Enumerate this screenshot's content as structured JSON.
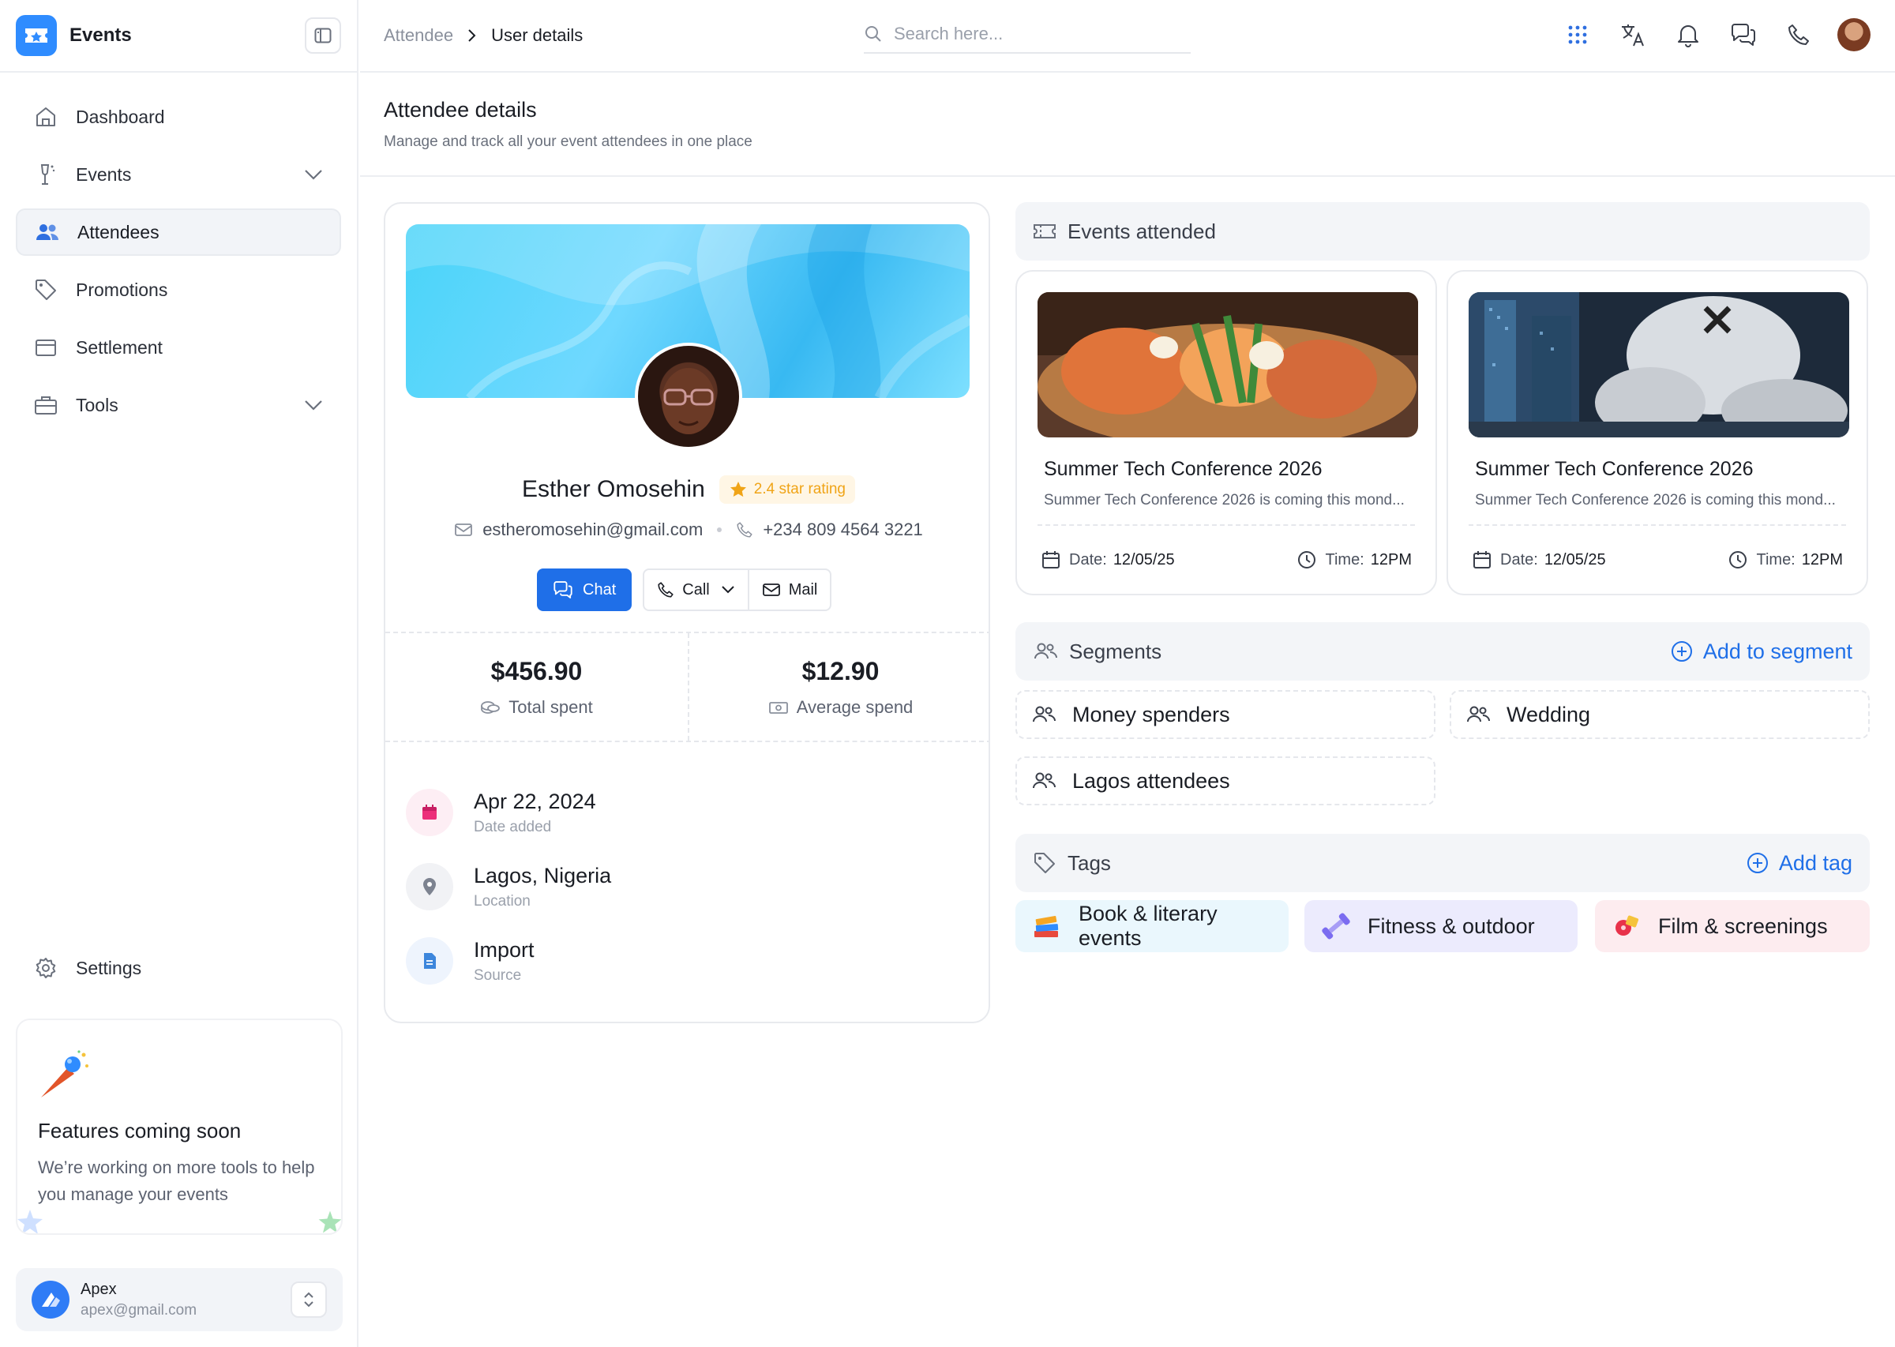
{
  "app": {
    "name": "Events"
  },
  "sidebar": {
    "items": [
      {
        "label": "Dashboard"
      },
      {
        "label": "Events"
      },
      {
        "label": "Attendees"
      },
      {
        "label": "Promotions"
      },
      {
        "label": "Settlement"
      },
      {
        "label": "Tools"
      }
    ],
    "settings_label": "Settings",
    "promo": {
      "title": "Features coming soon",
      "text": "We’re working on more tools to help you manage your events"
    },
    "account": {
      "name": "Apex",
      "email": "apex@gmail.com"
    }
  },
  "header": {
    "breadcrumb": [
      "Attendee",
      "User details"
    ],
    "search_placeholder": "Search here..."
  },
  "page": {
    "title": "Attendee details",
    "subtitle": "Manage and track all your event attendees in one place"
  },
  "profile": {
    "name": "Esther Omosehin",
    "rating": "2.4 star rating",
    "email": "estheromosehin@gmail.com",
    "phone": "+234 809 4564 3221",
    "actions": {
      "chat": "Chat",
      "call": "Call",
      "mail": "Mail"
    },
    "stats": [
      {
        "value": "$456.90",
        "label": "Total spent"
      },
      {
        "value": "$12.90",
        "label": "Average spend"
      }
    ],
    "info": [
      {
        "value": "Apr 22, 2024",
        "label": "Date added"
      },
      {
        "value": "Lagos, Nigeria",
        "label": "Location"
      },
      {
        "value": "Import",
        "label": "Source"
      }
    ]
  },
  "events_attended": {
    "title": "Events attended",
    "cards": [
      {
        "title": "Summer Tech Conference 2026",
        "desc": "Summer Tech Conference 2026 is coming this mond...",
        "date_label": "Date:",
        "date": "12/05/25",
        "time_label": "Time:",
        "time": "12PM"
      },
      {
        "title": "Summer Tech Conference 2026",
        "desc": "Summer Tech Conference 2026 is coming this mond...",
        "date_label": "Date:",
        "date": "12/05/25",
        "time_label": "Time:",
        "time": "12PM"
      }
    ]
  },
  "segments": {
    "title": "Segments",
    "action": "Add to segment",
    "items": [
      "Money spenders",
      "Wedding",
      "Lagos attendees"
    ]
  },
  "tags": {
    "title": "Tags",
    "action": "Add tag",
    "items": [
      {
        "label": "Book & literary events",
        "bg": "#eaf7fd"
      },
      {
        "label": "Fitness & outdoor",
        "bg": "#ecebfd"
      },
      {
        "label": "Film & screenings",
        "bg": "#fdecef"
      }
    ]
  },
  "colors": {
    "accent": "#1f6fe8",
    "star": "#f0a417"
  }
}
